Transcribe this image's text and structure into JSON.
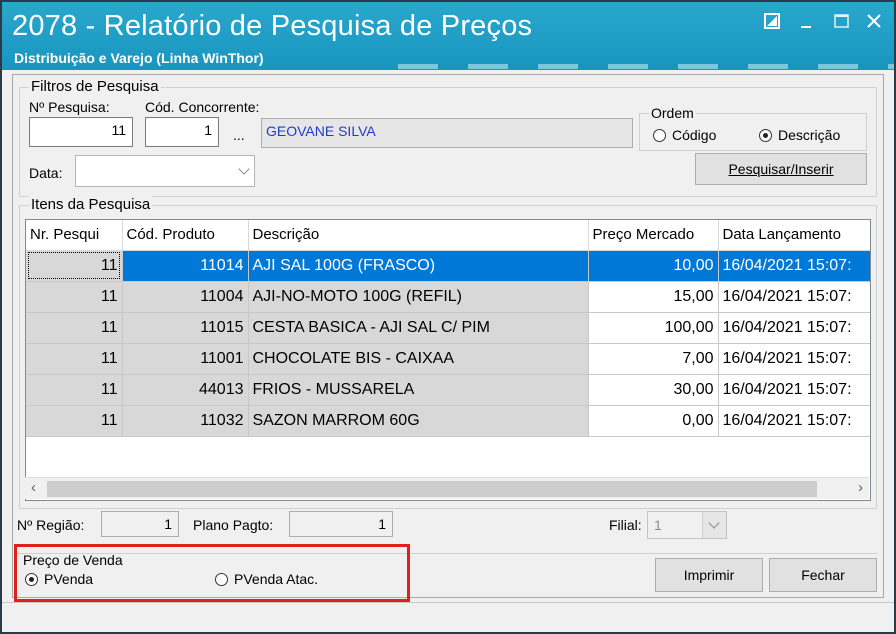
{
  "window": {
    "title": "2078 - Relatório de Pesquisa de Preços",
    "subtitle": "Distribuição e Varejo (Linha WinThor)"
  },
  "filters": {
    "group_label": "Filtros de Pesquisa",
    "nr_pesquisa_label": "Nº Pesquisa:",
    "nr_pesquisa_value": "11",
    "cod_concorrente_label": "Cód. Concorrente:",
    "cod_concorrente_value": "1",
    "ellipsis": "...",
    "concorrente_name": "GEOVANE SILVA",
    "data_label": "Data:",
    "data_value": "",
    "ordem": {
      "label": "Ordem",
      "options": [
        "Código",
        "Descrição"
      ],
      "selected": "Descrição"
    },
    "search_button": "Pesquisar/Inserir"
  },
  "items": {
    "group_label": "Itens da Pesquisa",
    "columns": [
      "Nr. Pesqui",
      "Cód. Produto",
      "Descrição",
      "Preço Mercado",
      "Data Lançamento"
    ],
    "rows": [
      {
        "nr": "11",
        "cod": "11014",
        "desc": "AJI SAL 100G (FRASCO)",
        "preco": "10,00",
        "data": "16/04/2021 15:07:"
      },
      {
        "nr": "11",
        "cod": "11004",
        "desc": "AJI-NO-MOTO 100G (REFIL)",
        "preco": "15,00",
        "data": "16/04/2021 15:07:"
      },
      {
        "nr": "11",
        "cod": "11015",
        "desc": "CESTA BASICA - AJI SAL C/ PIM",
        "preco": "100,00",
        "data": "16/04/2021 15:07:"
      },
      {
        "nr": "11",
        "cod": "11001",
        "desc": "CHOCOLATE BIS  - CAIXAA",
        "preco": "7,00",
        "data": "16/04/2021 15:07:"
      },
      {
        "nr": "11",
        "cod": "44013",
        "desc": "FRIOS - MUSSARELA",
        "preco": "30,00",
        "data": "16/04/2021 15:07:"
      },
      {
        "nr": "11",
        "cod": "11032",
        "desc": "SAZON MARROM 60G",
        "preco": "0,00",
        "data": "16/04/2021 15:07:"
      }
    ],
    "selected_row": 0
  },
  "footer": {
    "regiao_label": "Nº Região:",
    "regiao_value": "1",
    "plano_label": "Plano Pagto:",
    "plano_value": "1",
    "filial_label": "Filial:",
    "filial_value": "1"
  },
  "preco_venda": {
    "label": "Preço de Venda",
    "options": [
      "PVenda",
      "PVenda Atac."
    ],
    "selected": "PVenda"
  },
  "buttons": {
    "print": "Imprimir",
    "close": "Fechar"
  },
  "colors": {
    "title_bar": "#1896c0",
    "selection": "#0078d7",
    "highlight_box": "#e0201c",
    "link_text": "#1f3ccc"
  }
}
